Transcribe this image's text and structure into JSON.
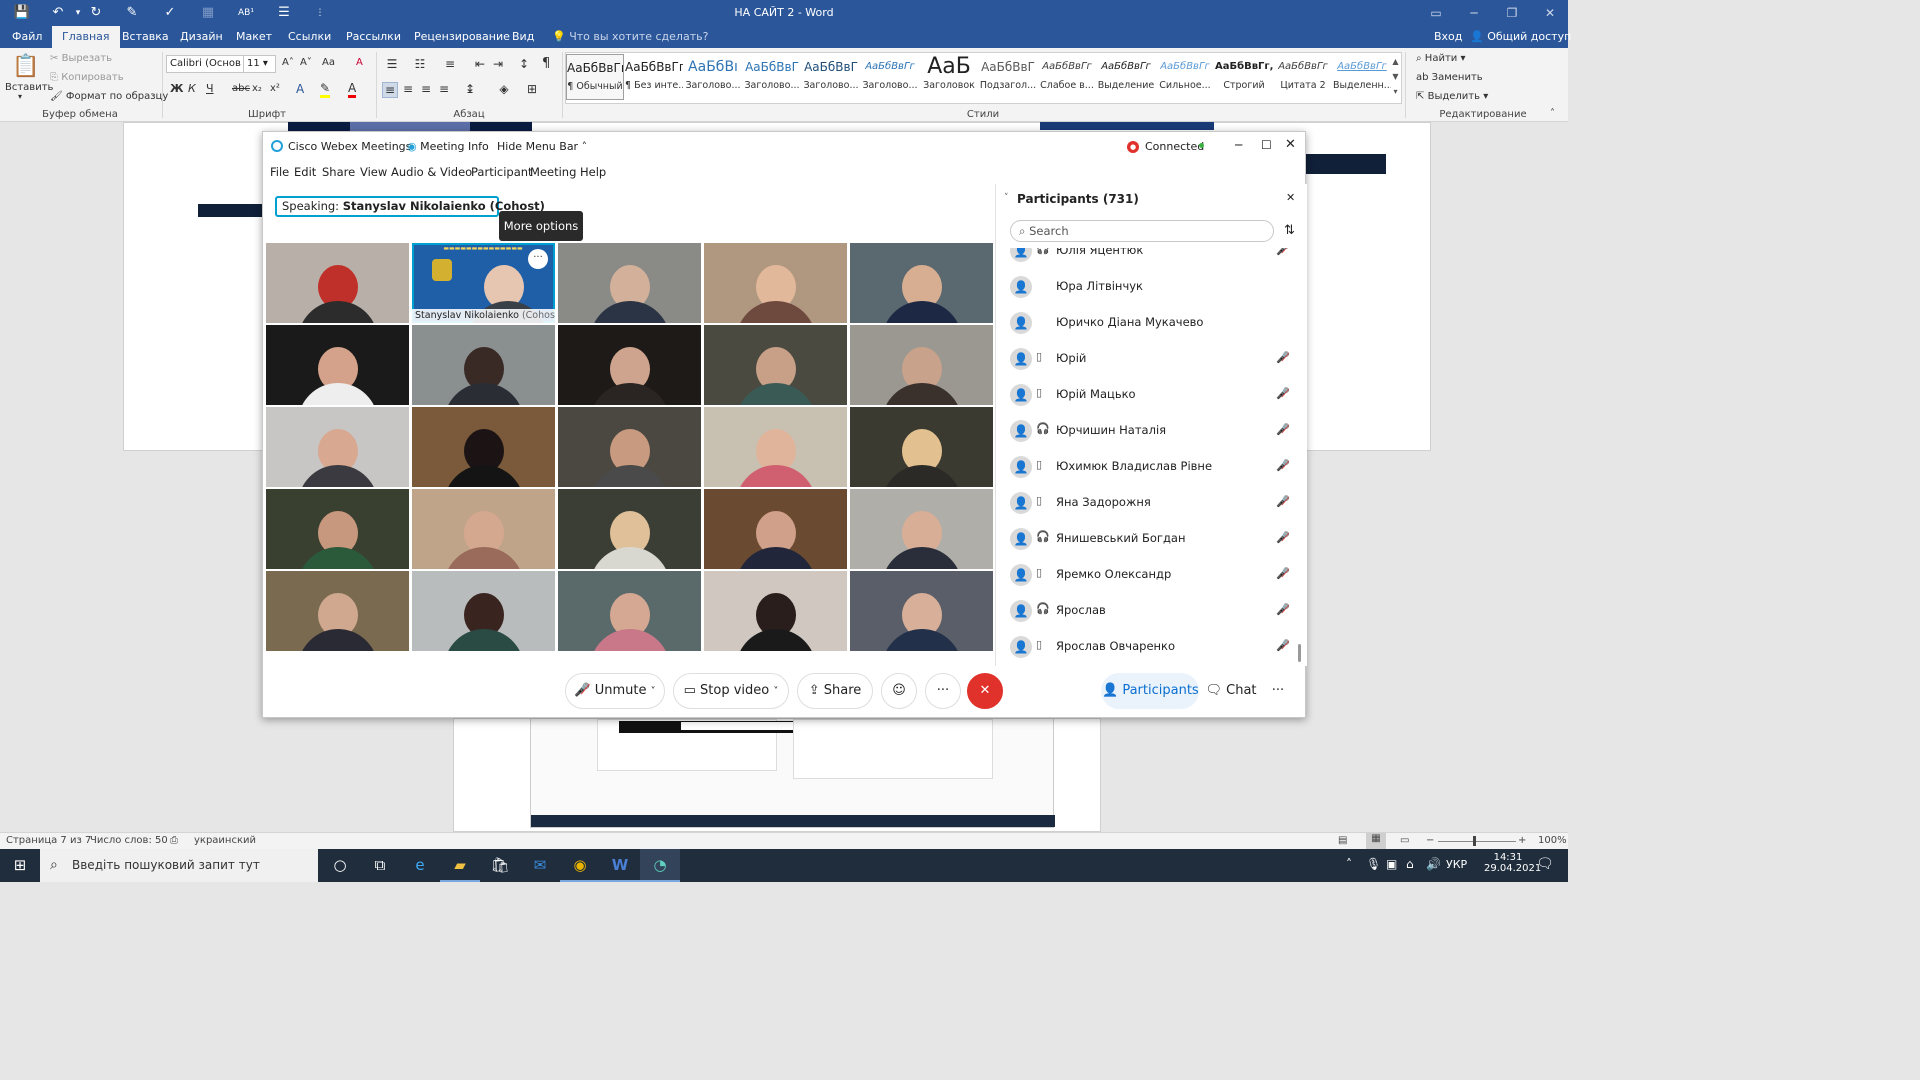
{
  "word": {
    "title": "НА САЙТ 2 - Word",
    "quick_access": [
      "save-icon",
      "undo-icon",
      "redo-icon",
      "touch-icon",
      "spelling-icon",
      "table-icon",
      "superscript-icon",
      "form-icon",
      "customize-icon"
    ],
    "window_controls": [
      "ribbon-display-icon",
      "minimize-icon",
      "restore-icon",
      "close-icon"
    ],
    "tabs": [
      "Файл",
      "Главная",
      "Вставка",
      "Дизайн",
      "Макет",
      "Ссылки",
      "Рассылки",
      "Рецензирование",
      "Вид"
    ],
    "active_tab": "Главная",
    "tell_me": "Что вы хотите сделать?",
    "sign_in": "Вход",
    "share": "Общий доступ",
    "clipboard": {
      "paste": "Вставить",
      "cut": "Вырезать",
      "copy": "Копировать",
      "format_painter": "Формат по образцу",
      "group": "Буфер обмена"
    },
    "font": {
      "name": "Calibri (Основ",
      "size": "11",
      "group": "Шрифт",
      "bold": "Ж",
      "italic": "К",
      "underline": "Ч",
      "strike": "abc",
      "sub": "x₂",
      "sup": "x²",
      "grow": "A˄",
      "shrink": "A˅",
      "case": "Aa",
      "clear": "A"
    },
    "paragraph": {
      "group": "Абзац",
      "pilcrow": "¶"
    },
    "styles": {
      "group": "Стили",
      "items": [
        {
          "preview": "АаБбВвГг,",
          "name": "¶ Обычный"
        },
        {
          "preview": "АаБбВвГг,",
          "name": "¶ Без инте..."
        },
        {
          "preview": "АаБбВı",
          "name": "Заголово..."
        },
        {
          "preview": "АаБбВвГ",
          "name": "Заголово..."
        },
        {
          "preview": "АаБбВвГ",
          "name": "Заголово..."
        },
        {
          "preview": "АаБбВвГг",
          "name": "Заголово..."
        },
        {
          "preview": "АаБ",
          "name": "Заголовок"
        },
        {
          "preview": "АаБбВвГ",
          "name": "Подзагол..."
        },
        {
          "preview": "АаБбВвГг",
          "name": "Слабое в..."
        },
        {
          "preview": "АаБбВвГг",
          "name": "Выделение"
        },
        {
          "preview": "АаБбВвГг",
          "name": "Сильное..."
        },
        {
          "preview": "АаБбВвГг,",
          "name": "Строгий"
        },
        {
          "preview": "АаБбВвГг",
          "name": "Цитата 2"
        },
        {
          "preview": "АаБбВвГг",
          "name": "Выделенн..."
        }
      ]
    },
    "editing": {
      "find": "Найти",
      "replace": "Заменить",
      "select": "Выделить",
      "group": "Редактирование"
    },
    "status": {
      "page": "Страница 7 из 7",
      "words": "Число слов: 50",
      "language": "украинский",
      "zoom": "100%"
    }
  },
  "webex": {
    "app_name": "Cisco Webex Meetings",
    "meeting_info": "Meeting Info",
    "hide_menu": "Hide Menu Bar",
    "connection": "Connected",
    "menu": [
      "File",
      "Edit",
      "Share",
      "View",
      "Audio & Video",
      "Participant",
      "Meeting",
      "Help"
    ],
    "speaking_label": "Speaking:",
    "speaking_name": "Stanyslav Nikolaienko (Cohost)",
    "tooltip": "More options",
    "selected_tile_name": "Stanyslav Nikolaienko",
    "selected_tile_role": "(Cohost)",
    "controls": {
      "unmute": "Unmute",
      "stop_video": "Stop video",
      "share": "Share",
      "participants": "Participants",
      "chat": "Chat"
    },
    "participants": {
      "title": "Participants (731)",
      "search_placeholder": "Search",
      "items": [
        {
          "name": "Юлія Яцентюк",
          "device": "headset"
        },
        {
          "name": "Юра Літвінчук",
          "device": ""
        },
        {
          "name": "Юричко Діана Мукачево",
          "device": ""
        },
        {
          "name": "Юрій",
          "device": "phone"
        },
        {
          "name": "Юрій Мацько",
          "device": "phone"
        },
        {
          "name": "Юрчишин Наталія",
          "device": "headset"
        },
        {
          "name": "Юхимюк Владислав Рівне",
          "device": "phone"
        },
        {
          "name": "Яна Задорожня",
          "device": "phone"
        },
        {
          "name": "Янишевський Богдан",
          "device": "headset"
        },
        {
          "name": "Яремко Олександр",
          "device": "phone"
        },
        {
          "name": "Ярослав",
          "device": "headset"
        },
        {
          "name": "Ярослав Овчаренко",
          "device": "phone"
        }
      ]
    }
  },
  "taskbar": {
    "search_placeholder": "Введіть пошуковий запит тут",
    "apps": [
      "windows-start-icon",
      "search-icon",
      "task-view-icon",
      "edge-icon",
      "file-explorer-icon",
      "store-icon",
      "mail-icon",
      "chrome-icon",
      "word-icon",
      "webex-icon"
    ],
    "language": "УКР",
    "time": "14:31",
    "date": "29.04.2021"
  },
  "colors": {
    "word_blue": "#2b579a",
    "webex_red": "#e0322a",
    "connected_green": "#3cb043",
    "selected_tile": "#00a0d1",
    "participants_blue": "#0b6fd0"
  }
}
